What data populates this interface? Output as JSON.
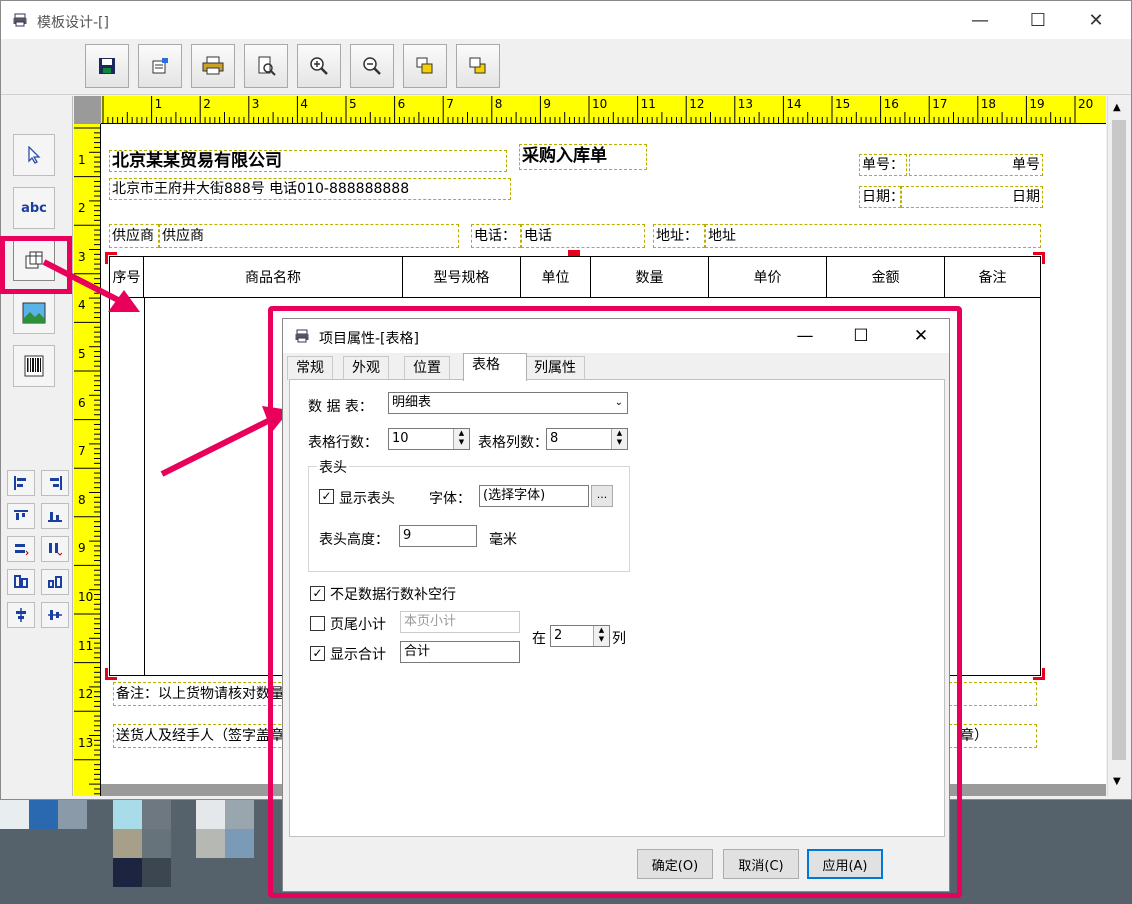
{
  "window": {
    "title": "模板设计-[]"
  },
  "toolbar": {
    "buttons": [
      "save-icon",
      "properties-icon",
      "print-icon",
      "print-preview-icon",
      "zoom-in-icon",
      "zoom-out-icon",
      "bring-front-icon",
      "send-back-icon"
    ]
  },
  "toolbox": {
    "buttons": [
      "pointer-icon",
      "text-icon",
      "table-icon",
      "image-icon",
      "barcode-icon"
    ],
    "text_label": "abc"
  },
  "ruler": {
    "h_numbers": [
      "1",
      "2",
      "3",
      "4",
      "5",
      "6",
      "7",
      "8",
      "9",
      "10",
      "11",
      "12",
      "13",
      "14",
      "15",
      "16",
      "17",
      "18",
      "19",
      "20"
    ],
    "v_numbers": [
      "1",
      "2",
      "3",
      "4",
      "5",
      "6",
      "7",
      "8",
      "9",
      "10",
      "11",
      "12",
      "13"
    ]
  },
  "template": {
    "company_name": "北京某某贸易有限公司",
    "doc_title": "采购入库单",
    "address": "北京市王府井大街888号  电话010-888888888",
    "order_no_label": "单号：",
    "order_no_value": "单号",
    "date_label": "日期：",
    "date_value": "日期",
    "supplier_label": "供应商",
    "supplier_value": "供应商",
    "phone_label": "电话：",
    "phone_value": "电话",
    "addr_label": "地址：",
    "addr_value": "地址",
    "table_headers": [
      "序号",
      "商品名称",
      "型号规格",
      "单位",
      "数量",
      "单价",
      "金额",
      "备注"
    ],
    "remark_text": "备注：以上货物请核对数量",
    "sign_text": "送货人及经手人（签字盖章",
    "sign_tail": "章）"
  },
  "dialog": {
    "title": "项目属性-[表格]",
    "tabs": [
      "常规",
      "外观",
      "位置",
      "表格",
      "列属性"
    ],
    "active_tab": "表格",
    "datasource_label": "数 据 表：",
    "datasource_value": "明细表",
    "rows_label": "表格行数：",
    "rows_value": "10",
    "cols_label": "表格列数：",
    "cols_value": "8",
    "header_group_label": "表头",
    "show_header_label": "显示表头",
    "show_header_checked": true,
    "font_label": "字体：",
    "font_value": "(选择字体)",
    "font_more": "...",
    "header_height_label": "表头高度：",
    "header_height_value": "9",
    "header_height_unit": "毫米",
    "fill_rows_label": "不足数据行数补空行",
    "fill_rows_checked": true,
    "page_subtotal_label": "页尾小计",
    "page_subtotal_checked": false,
    "page_subtotal_placeholder": "本页小计",
    "show_total_label": "显示合计",
    "show_total_checked": true,
    "total_value": "合计",
    "at_label": "在",
    "at_value": "2",
    "col_label": "列",
    "ok_label": "确定(O)",
    "cancel_label": "取消(C)",
    "apply_label": "应用(A)"
  },
  "colors": {
    "highlight": "#e8005a",
    "ruler": "#ffff00",
    "field_border": "#b8b000"
  }
}
